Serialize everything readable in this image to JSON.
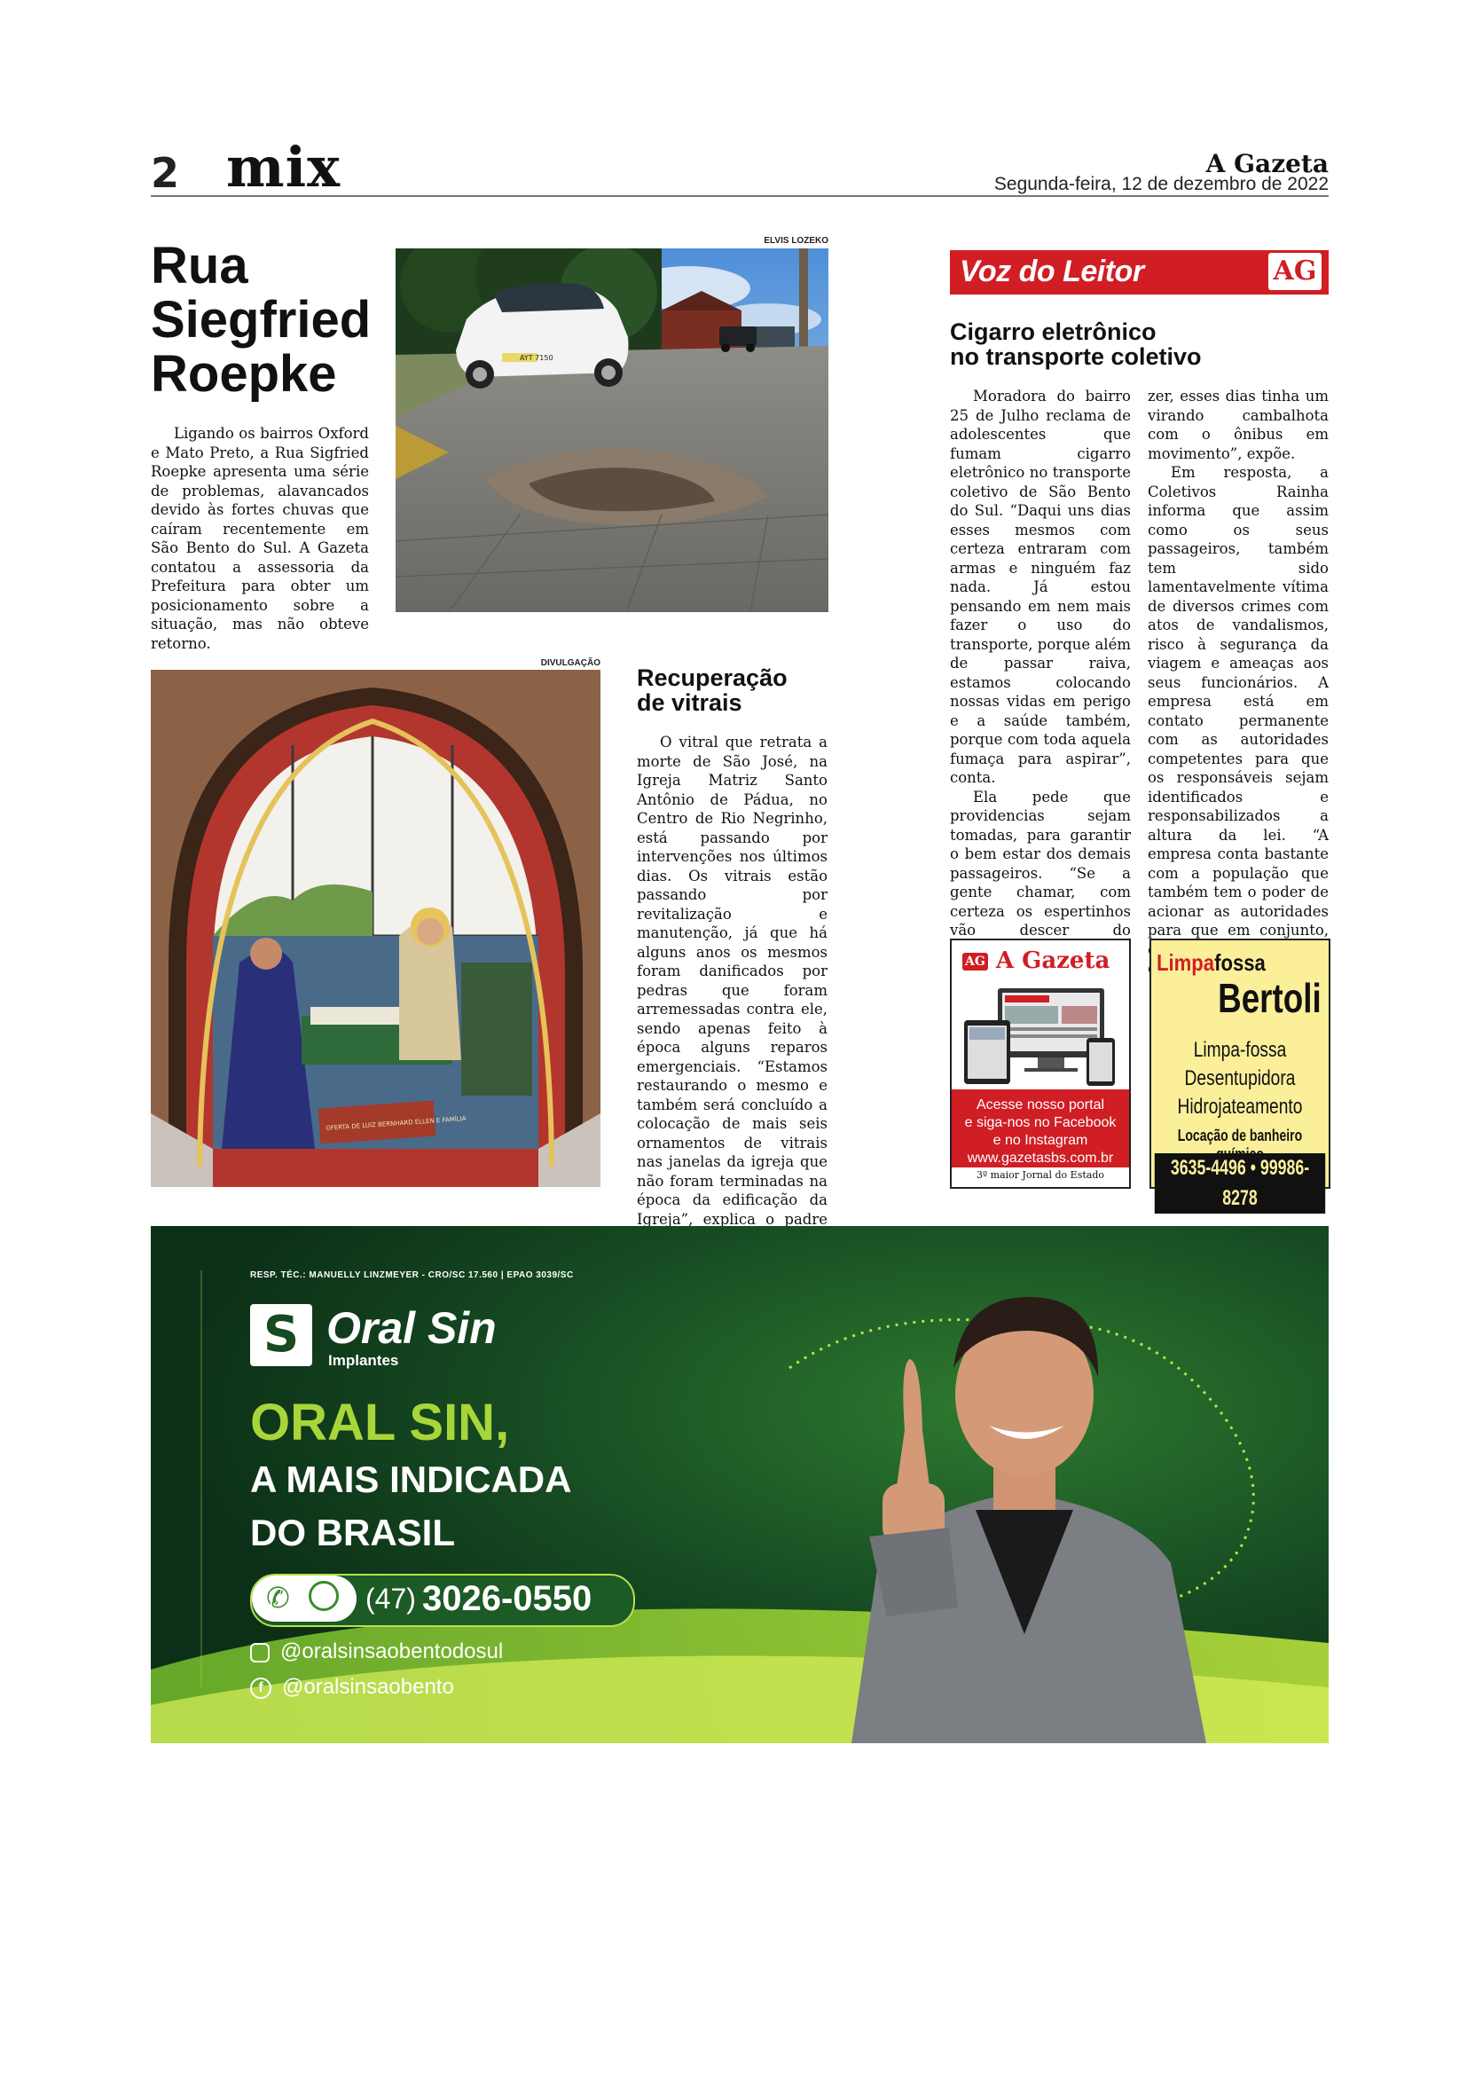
{
  "header": {
    "page_number": "2",
    "section": "mix",
    "masthead": "A Gazeta",
    "date": "Segunda-feira, 12 de dezembro de 2022"
  },
  "article1": {
    "title_lines": [
      "Rua",
      "Siegfried",
      "Roepke"
    ],
    "body": "Ligando os bairros Oxford e Mato Preto, a Rua Sigfried Roepke apresenta uma série de problemas, alavancados devido às fortes chuvas que caíram recentemente em São Bento do Sul. A Gazeta contatou a assessoria da Prefeitura para obter um posicionamento sobre a situação, mas não obteve retorno.",
    "photo_credit": "ELVIS LOZEKO",
    "plate": "AYT 7150"
  },
  "article2": {
    "title_lines": [
      "Recuperação",
      "de vitrais"
    ],
    "body": "O vitral que retrata a morte de São José, na Igreja Matriz Santo Antônio de Pádua, no Centro de Rio Negrinho, está passando por intervenções nos últimos dias. Os vitrais estão passando por revitalização e manutenção, já que há alguns anos os mesmos foram danificados por pedras que foram arremessadas contra ele, sendo apenas feito à época alguns reparos emergenciais. “Estamos restaurando o mesmo e também será concluído a colocação de mais seis ornamentos de vitrais nas janelas da igreja que não foram terminadas na época da edificação da Igreja”, explica o padre Magnos Caneppele, pároco da Matriz.",
    "photo_credit": "DIVULGAÇÃO",
    "window_inscription": "OFERTA DE LUIZ BERNHARD ELLEN E FAMÍLIA"
  },
  "voz": {
    "banner": "Voz do Leitor",
    "logo": "AG",
    "title_lines": [
      "Cigarro eletrônico",
      "no transporte coletivo"
    ],
    "col1": [
      "Moradora do bairro 25 de Julho reclama de adolescentes que fumam cigarro eletrônico no transporte coletivo de São Bento do Sul. “Daqui uns dias esses mesmos com certeza entraram com armas e ninguém faz nada. Já estou pensando em nem mais fazer o uso do transporte, porque além de passar raiva, estamos colocando nossas vidas em perigo e a saúde também, porque com toda aquela fumaça para aspirar”, conta.",
      "Ela pede que providencias sejam tomadas, para garantir o bem estar dos demais passageiros. “Se a gente chamar, com certeza os espertinhos vão descer do transporte. Já não sabemos o que fa-"
    ],
    "col2": [
      "zer, esses dias tinha um virando cambalhota com o ônibus em movimento”, expõe.",
      "Em resposta, a Coletivos Rainha informa que assim como os seus passageiros, também tem sido lamentavelmente vítima de diversos crimes com atos de vandalismos, risco à segurança da viagem e ameaças aos seus funcionários. A empresa está em contato permanente com as autoridades competentes para que os responsáveis sejam identificados e responsabilizados a altura da lei. “A empresa conta bastante com a população que também tem o poder de acionar as autoridades para que em conjunto, combatermos estes crimes”, finaliza a nota."
    ]
  },
  "ad_gazeta": {
    "logo_badge": "AG",
    "logo_name": "A Gazeta",
    "line1": "Acesse nosso portal",
    "line2": "e siga-nos no Facebook",
    "line3": "e no Instagram",
    "url": "www.gazetasbs.com.br",
    "footer": "3º maior Jornal do Estado"
  },
  "ad_bertoli": {
    "brand_a": "Limpa",
    "brand_b": "fossa",
    "name": "Bertoli",
    "s1": "Limpa-fossa",
    "s2": "Desentupidora",
    "s3": "Hidrojateamento",
    "s4": "Locação de banheiro químico",
    "phones": "3635-4496 • 99986-8278"
  },
  "ad_oral": {
    "resp": "RESP. TÉC.: MANUELLY LINZMEYER - CRO/SC 17.560 | EPAO 3039/SC",
    "brand": "Oral Sin",
    "sub": "Implantes",
    "head1": "ORAL SIN,",
    "head2": "A MAIS INDICADA",
    "head3": "DO BRASIL",
    "ddd": "(47)",
    "phone": "3026-0550",
    "instagram": "@oralsinsaobentodosul",
    "facebook": "@oralsinsaobento",
    "colors": {
      "green_dark": "#0f3d1c",
      "green_light": "#a8d63a",
      "white": "#ffffff"
    }
  }
}
